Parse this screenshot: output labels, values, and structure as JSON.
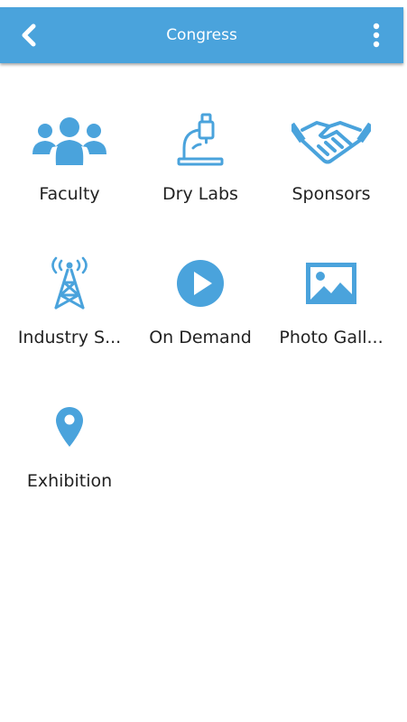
{
  "header": {
    "title": "Congress",
    "back_icon": "chevron-left-icon",
    "menu_icon": "more-vertical-icon",
    "color": "#4aa3dc"
  },
  "accent_color": "#4aa3dc",
  "menu_items": [
    {
      "label": "Faculty",
      "icon": "group-people-icon"
    },
    {
      "label": "Dry Labs",
      "icon": "microscope-icon"
    },
    {
      "label": "Sponsors",
      "icon": "handshake-icon"
    },
    {
      "label": "Industry S...",
      "icon": "broadcast-tower-icon"
    },
    {
      "label": "On Demand",
      "icon": "play-circle-icon"
    },
    {
      "label": "Photo Gall...",
      "icon": "image-icon"
    },
    {
      "label": "Exhibition",
      "icon": "map-pin-icon"
    }
  ]
}
